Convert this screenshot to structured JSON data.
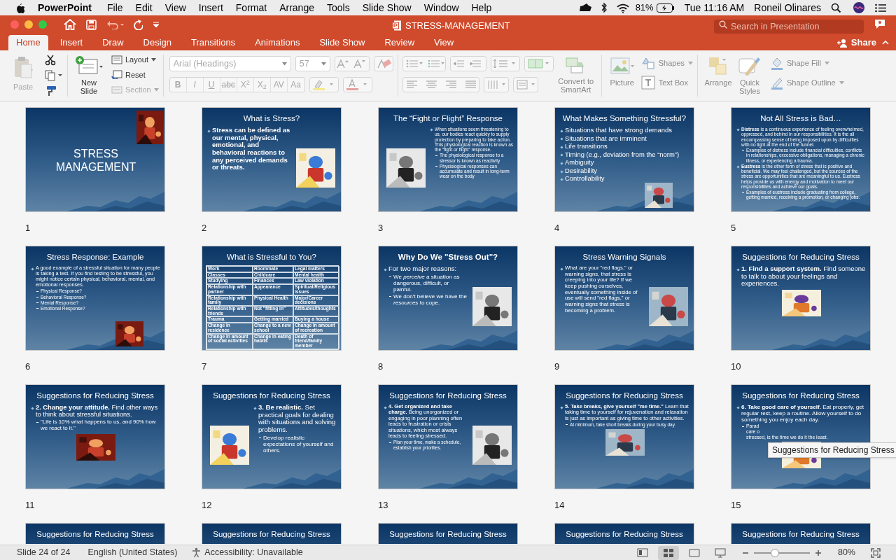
{
  "menu_bar": {
    "app": "PowerPoint",
    "items": [
      "File",
      "Edit",
      "View",
      "Insert",
      "Format",
      "Arrange",
      "Tools",
      "Slide Show",
      "Window",
      "Help"
    ],
    "battery": "81%",
    "clock": "Tue 11:16 AM",
    "user": "Roneil Olinares"
  },
  "title_bar": {
    "title": "STRESS-MANAGEMENT",
    "search": {
      "placeholder": "Search in Presentation"
    }
  },
  "tabs": [
    {
      "label": "Home",
      "selected": true
    },
    {
      "label": "Insert",
      "selected": false
    },
    {
      "label": "Draw",
      "selected": false
    },
    {
      "label": "Design",
      "selected": false
    },
    {
      "label": "Transitions",
      "selected": false
    },
    {
      "label": "Animations",
      "selected": false
    },
    {
      "label": "Slide Show",
      "selected": false
    },
    {
      "label": "Review",
      "selected": false
    },
    {
      "label": "View",
      "selected": false
    }
  ],
  "share": "Share",
  "ribbon": {
    "paste": {
      "label": "Paste",
      "disabled": true
    },
    "new_slide": "New Slide",
    "layout": {
      "label": "Layout",
      "disabled": false
    },
    "reset": {
      "label": "Reset",
      "disabled": false
    },
    "section": {
      "label": "Section",
      "disabled": true
    },
    "font_name": {
      "value": "Arial (Headings)",
      "disabled": true
    },
    "font_size": {
      "value": "57",
      "disabled": true
    },
    "format_buttons": [
      {
        "label": "B",
        "disabled": true
      },
      {
        "label": "I",
        "disabled": true
      },
      {
        "label": "U",
        "disabled": true
      },
      {
        "label": "abc",
        "disabled": true
      },
      {
        "label": "X$^{2}$",
        "disabled": true
      },
      {
        "label": "X$_{2}$",
        "disabled": true
      },
      {
        "label": "AV",
        "disabled": true
      },
      {
        "label": "Aa",
        "disabled": true
      }
    ],
    "convert": "Convert to SmartArt",
    "picture": "Picture",
    "shapes": "Shapes",
    "text_box": "Text Box",
    "arrange": "Arrange",
    "quick_styles": "Quick Styles",
    "shape_fill": "Shape Fill",
    "shape_outline": "Shape Outline"
  },
  "slides": [
    {
      "number": "1",
      "kind": "title",
      "title": "STRESS MANAGEMENT",
      "title_bold": false,
      "picture": {
        "kind": "picture"
      }
    },
    {
      "number": "2",
      "kind": "side",
      "title": "What is Stress?",
      "title_bold": false,
      "bullets": [
        {
          "text": "Stress can be defined as our mental, physical, emotional, and behavioral reactions to any perceived demands or threats.",
          "bold": true
        }
      ],
      "picture": {
        "kind": "picture"
      }
    },
    {
      "number": "3",
      "kind": "side-left",
      "title": "The “Fight or Flight” Response",
      "title_bold": false,
      "bullets": [
        {
          "text": "When situations seem threatening to us, our bodies react quickly to supply protection by preparing to take action. This physiological reaction is known as the “fight or flight” response.",
          "bold": false,
          "children": [
            {
              "text": "The physiological response to a stressor is known as reactivity",
              "bold": false
            },
            {
              "text": "Physiological responses can accumulate and result in long-term wear on the body",
              "bold": false
            }
          ]
        }
      ],
      "picture": {
        "kind": "picture"
      }
    },
    {
      "number": "4",
      "kind": "inset",
      "title": "What Makes Something Stressful?",
      "title_bold": false,
      "bullets": [
        {
          "text": "Situations that have strong demands",
          "bold": false
        },
        {
          "text": "Situations that are imminent",
          "bold": false
        },
        {
          "text": "Life transitions",
          "bold": false
        },
        {
          "text": "Timing (e.g., deviation from the “norm”)",
          "bold": false
        },
        {
          "text": "Ambiguity",
          "bold": false
        },
        {
          "text": "Desirability",
          "bold": false
        },
        {
          "text": "Controllability",
          "bold": false
        }
      ],
      "picture": {
        "kind": "picture"
      }
    },
    {
      "number": "5",
      "kind": "text",
      "title": "Not All Stress is Bad…",
      "title_bold": false,
      "bullets": [
        {
          "text": "**Distress** is a continuous experience of feeling overwhelmed, oppressed, and behind in our responsibilities. It is the all encompassing sense of being imposed upon by difficulties with no light at the end of the tunnel.",
          "bold": false,
          "children": [
            {
              "text": "Examples of distress include financial difficulties, conflicts in relationships, excessive obligations, managing a chronic illness, or experiencing a trauma.",
              "bold": false
            }
          ]
        },
        {
          "text": "**Eustress** is the other form of stress that is positive and beneficial. We may feel challenged, but the sources of the stress are opportunities that are meaningful to us. Eustress helps provide us with energy and motivation to meet our responsibilities and achieve our goals.",
          "bold": false,
          "children": [
            {
              "text": "Examples of eustress include graduating from college, getting married, receiving a promotion, or changing jobs.",
              "bold": false
            }
          ]
        }
      ]
    },
    {
      "number": "6",
      "kind": "inset",
      "title": "Stress Response: Example",
      "title_bold": false,
      "bullets": [
        {
          "text": "A good example of a stressful situation for many people is taking a test. If you find testing to be stressful, you might notice certain physical, behavioral, mental, and emotional responses.",
          "bold": false,
          "children": [
            {
              "text": "Physical Response?",
              "bold": false
            },
            {
              "text": "Behavioral Response?",
              "bold": false
            },
            {
              "text": "Mental Response?",
              "bold": false
            },
            {
              "text": "Emotional Response?",
              "bold": false
            }
          ]
        }
      ],
      "picture": {
        "kind": "picture"
      }
    },
    {
      "number": "7",
      "kind": "table",
      "title": "What is Stressful to You?",
      "title_bold": false,
      "table": [
        [
          "Work",
          "Roommate",
          "Legal matters"
        ],
        [
          "Classes",
          "Childcare",
          "Mental health"
        ],
        [
          "Studying",
          "Finances",
          "Law violation"
        ],
        [
          "Relationship with partner",
          "Appearance",
          "Spiritual/Religious issues"
        ],
        [
          "Relationship with family",
          "Physical Health",
          "Major/Career decisions"
        ],
        [
          "Relationship with friends",
          "Not \"fitting in\"",
          "Attitudes/thoughts"
        ],
        [
          "Trauma",
          "Getting married",
          "Buying a house"
        ],
        [
          "Change in residence",
          "Change to a new school",
          "Change in amount of recreation"
        ],
        [
          "Change in amount of social activities",
          "Change in eating habits",
          "Death of friend/family member"
        ]
      ]
    },
    {
      "number": "8",
      "kind": "side",
      "title": "Why Do We \"Stress Out\"?",
      "title_bold": true,
      "bullets": [
        {
          "text": "For two major reasons:",
          "bold": false,
          "children": [
            {
              "text": "We *perceive* a situation as dangerous, difficult, or painful.",
              "bold": false
            },
            {
              "text": "We don't believe we have the *resources* to cope.",
              "bold": false
            }
          ]
        }
      ],
      "picture": {
        "kind": "picture"
      }
    },
    {
      "number": "9",
      "kind": "side",
      "title": "Stress Warning Signals",
      "title_bold": false,
      "bullets": [
        {
          "text": "What are your \"red flags,\" or warning signs, that stress is creeping into your life? If we keep pushing ourselves, eventually something inside of use will send \"red flags,\" or warning signs that stress is becoming a problem.",
          "bold": false
        }
      ],
      "picture": {
        "kind": "picture"
      }
    },
    {
      "number": "10",
      "kind": "below",
      "title": "Suggestions for Reducing Stress",
      "title_bold": false,
      "bullets": [
        {
          "text": "**1. Find a support system.** Find someone to talk to about your feelings and experiences.",
          "bold": false
        }
      ],
      "picture": {
        "kind": "picture"
      }
    },
    {
      "number": "11",
      "kind": "below",
      "title": "Suggestions for Reducing Stress",
      "title_bold": false,
      "bullets": [
        {
          "text": "**2. Change your attitude.** Find other ways to think about stressful situations.",
          "bold": false,
          "children": [
            {
              "text": "\"Life is 10% what happens to us, and 90% how we react to it.\"",
              "bold": false
            }
          ]
        }
      ],
      "picture": {
        "kind": "picture"
      }
    },
    {
      "number": "12",
      "kind": "side-left",
      "title": "Suggestions for Reducing Stress",
      "title_bold": false,
      "bullets": [
        {
          "text": "**3. Be realistic.** Set practical goals for dealing with situations and solving problems.",
          "bold": false,
          "children": [
            {
              "text": "Develop realistic expectations of yourself and others.",
              "bold": false
            }
          ]
        }
      ],
      "picture": {
        "kind": "picture"
      }
    },
    {
      "number": "13",
      "kind": "side",
      "title": "Suggestions for Reducing Stress",
      "title_bold": false,
      "bullets": [
        {
          "text": "**4. Get organized and take charge.** Being unorganized or engaging in poor planning often leads to frustration or crisis situations, which most always leads to feeling stressed.",
          "bold": false,
          "children": [
            {
              "text": "Plan your time, make a schedule, establish your priorities.",
              "bold": false
            }
          ]
        }
      ],
      "picture": {
        "kind": "picture"
      }
    },
    {
      "number": "14",
      "kind": "below",
      "title": "Suggestions for Reducing Stress",
      "title_bold": false,
      "bullets": [
        {
          "text": "**5. Take breaks, give yourself \"me time.\"** Learn that taking time to yourself for rejuvenation and relaxation is just as important as giving time to other activities.",
          "bold": false,
          "children": [
            {
              "text": "At minimum, take short breaks during your busy day.",
              "bold": false
            }
          ]
        }
      ],
      "picture": {
        "kind": "picture"
      }
    },
    {
      "number": "15",
      "kind": "below",
      "title": "Suggestions for Reducing Stress",
      "title_bold": false,
      "bullets": [
        {
          "text": "**6. Take good care of yourself.** Eat properly, get regular rest, keep a routine. Allow yourself to do something you enjoy each day.",
          "bold": false,
          "children": [
            {
              "lines": [
                "Parad",
                "care o",
                "stressed, is the time we do it the least."
              ],
              "bold": false
            }
          ]
        }
      ],
      "picture": {
        "kind": "picture"
      }
    },
    {
      "kind": "cut",
      "title": "Suggestions for Reducing Stress",
      "title_bold": false
    },
    {
      "kind": "cut",
      "title": "Suggestions for Reducing Stress",
      "title_bold": false
    },
    {
      "kind": "cut",
      "title": "Suggestions for Reducing Stress",
      "title_bold": false
    },
    {
      "kind": "cut",
      "title": "Suggestions for Reducing Stress",
      "title_bold": false
    },
    {
      "kind": "cut",
      "title": "Suggestions for Reducing Stress",
      "title_bold": false
    }
  ],
  "tooltip": "Suggestions for Reducing Stress",
  "status_bar": {
    "slide": "Slide 24 of 24",
    "language": "English (United States)",
    "accessibility": "Accessibility: Unavailable",
    "views": [
      {
        "selected": false
      },
      {
        "selected": true
      },
      {
        "selected": false
      },
      {
        "selected": false
      }
    ],
    "zoom_slider": {
      "level": 0.37
    },
    "zoom": "80%"
  }
}
